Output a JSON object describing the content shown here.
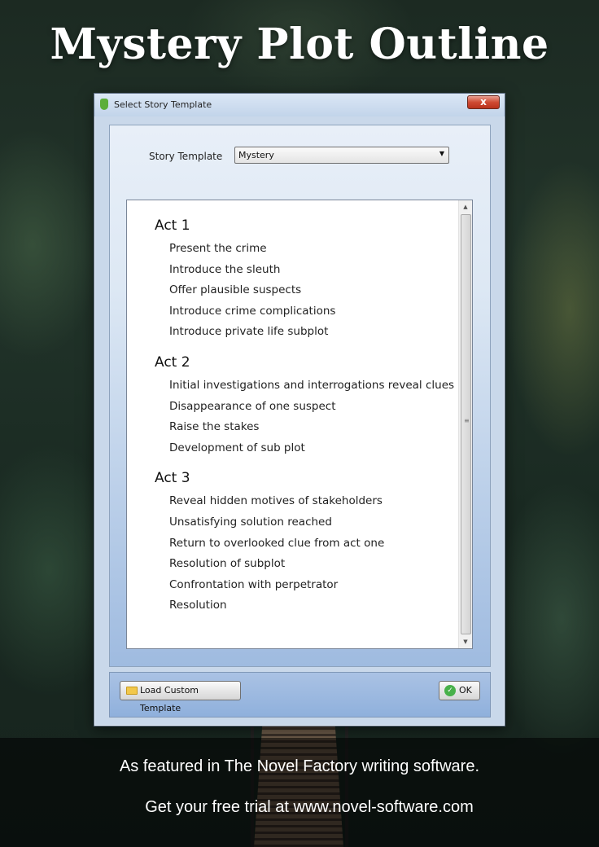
{
  "poster": {
    "title": "Mystery  Plot Outline",
    "tagline": "As featured in The Novel Factory writing software.",
    "cta": "Get your free trial at www.novel-software.com"
  },
  "window": {
    "title": "Select Story Template",
    "close_label": "x"
  },
  "template": {
    "label": "Story Template",
    "selected": "Mystery"
  },
  "outline": {
    "acts": [
      {
        "heading": "Act 1",
        "items": [
          "Present the crime",
          "Introduce the sleuth",
          "Offer plausible suspects",
          "Introduce crime complications",
          "Introduce private life subplot"
        ]
      },
      {
        "heading": "Act 2",
        "items": [
          "Initial investigations and interrogations reveal clues",
          "Disappearance of one suspect",
          "Raise the stakes",
          "Development of sub plot"
        ]
      },
      {
        "heading": "Act 3",
        "items": [
          "Reveal hidden motives of stakeholders",
          "Unsatisfying solution reached",
          "Return to overlooked clue from act one",
          "Resolution of subplot",
          "Confrontation with perpetrator",
          "Resolution"
        ]
      }
    ]
  },
  "buttons": {
    "load_custom": "Load Custom Template",
    "ok": "OK"
  },
  "icons": {
    "app": "app-icon",
    "close": "close-icon",
    "dropdown": "chevron-down-icon",
    "folder": "folder-icon",
    "ok": "check-icon",
    "scroll_up": "arrow-up-icon",
    "scroll_down": "arrow-down-icon"
  },
  "colors": {
    "close_button": "#cf4a33",
    "ok_check": "#48b14a",
    "folder": "#f2c84b",
    "window_frame": "#c9d8ea"
  }
}
